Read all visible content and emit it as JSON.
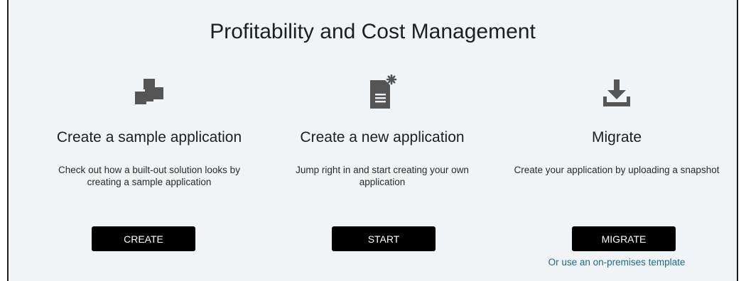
{
  "page": {
    "title": "Profitability and Cost Management"
  },
  "cards": [
    {
      "icon": "sample-app-blocks-icon",
      "heading": "Create a sample application",
      "description": "Check out how a built-out solution looks by creating a sample application",
      "button_label": "CREATE"
    },
    {
      "icon": "new-document-icon",
      "heading": "Create a new application",
      "description": "Jump right in and start creating your own application",
      "button_label": "START"
    },
    {
      "icon": "download-tray-icon",
      "heading": "Migrate",
      "description": "Create your application by uploading a snapshot",
      "button_label": "MIGRATE",
      "link_label": "Or use an on-premises template"
    }
  ],
  "colors": {
    "background": "#f1f4f7",
    "icon": "#555555",
    "button": "#000000",
    "link": "#1a6a8c"
  }
}
